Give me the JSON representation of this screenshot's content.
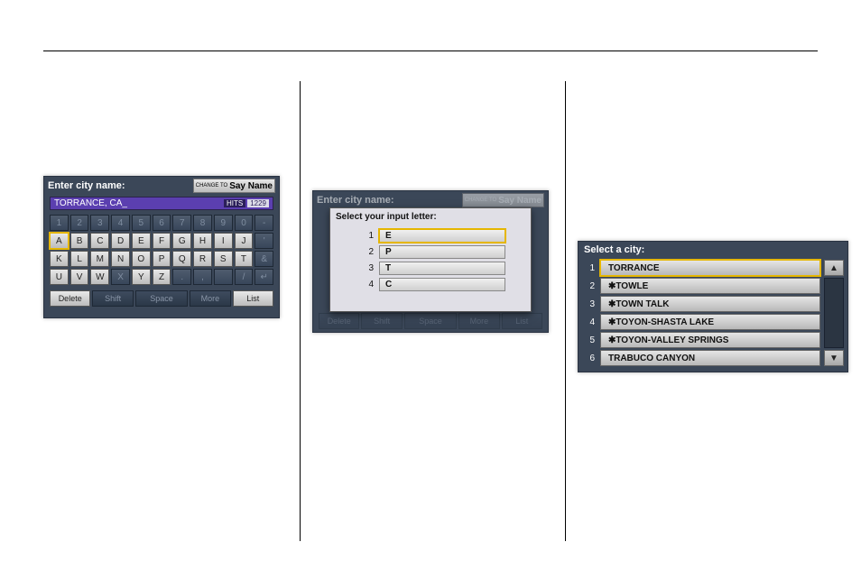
{
  "screen1": {
    "title": "Enter city name:",
    "say_name_small": "CHANGE TO",
    "say_name_big": "Say Name",
    "input_text": "TORRANCE, CA_",
    "hits_label": "HITS",
    "hits_count": "1229",
    "num_row": [
      "1",
      "2",
      "3",
      "4",
      "5",
      "6",
      "7",
      "8",
      "9",
      "0",
      "-"
    ],
    "row1": [
      "A",
      "B",
      "C",
      "D",
      "E",
      "F",
      "G",
      "H",
      "I",
      "J",
      "'"
    ],
    "row2": [
      "K",
      "L",
      "M",
      "N",
      "O",
      "P",
      "Q",
      "R",
      "S",
      "T",
      "&"
    ],
    "row3": [
      "U",
      "V",
      "W",
      "X",
      "Y",
      "Z",
      ".",
      ",",
      "",
      "/",
      "↵"
    ],
    "row1_active": [
      true,
      true,
      true,
      true,
      true,
      true,
      true,
      true,
      true,
      true,
      false
    ],
    "row2_active": [
      true,
      true,
      true,
      true,
      true,
      true,
      true,
      true,
      true,
      true,
      false
    ],
    "row3_active": [
      true,
      true,
      true,
      false,
      true,
      true,
      false,
      false,
      false,
      false,
      false
    ],
    "bottom": {
      "delete": "Delete",
      "shift": "Shift",
      "space": "Space",
      "more": "More",
      "list": "List"
    }
  },
  "screen2": {
    "behind_title": "Enter city name:",
    "say_name_small": "CHANGE TO",
    "say_name_big": "Say Name",
    "popup_title": "Select your input letter:",
    "options": [
      {
        "n": "1",
        "v": "E"
      },
      {
        "n": "2",
        "v": "P"
      },
      {
        "n": "3",
        "v": "T"
      },
      {
        "n": "4",
        "v": "C"
      }
    ],
    "bottom": {
      "delete": "Delete",
      "shift": "Shift",
      "space": "Space",
      "more": "More",
      "list": "List"
    }
  },
  "screen3": {
    "title": "Select a city:",
    "items": [
      {
        "n": "1",
        "v": "  TORRANCE"
      },
      {
        "n": "2",
        "v": "✱TOWLE"
      },
      {
        "n": "3",
        "v": "✱TOWN TALK"
      },
      {
        "n": "4",
        "v": "✱TOYON-SHASTA LAKE"
      },
      {
        "n": "5",
        "v": "✱TOYON-VALLEY SPRINGS"
      },
      {
        "n": "6",
        "v": "  TRABUCO CANYON"
      }
    ],
    "arrow_up": "▲",
    "arrow_down": "▼"
  }
}
